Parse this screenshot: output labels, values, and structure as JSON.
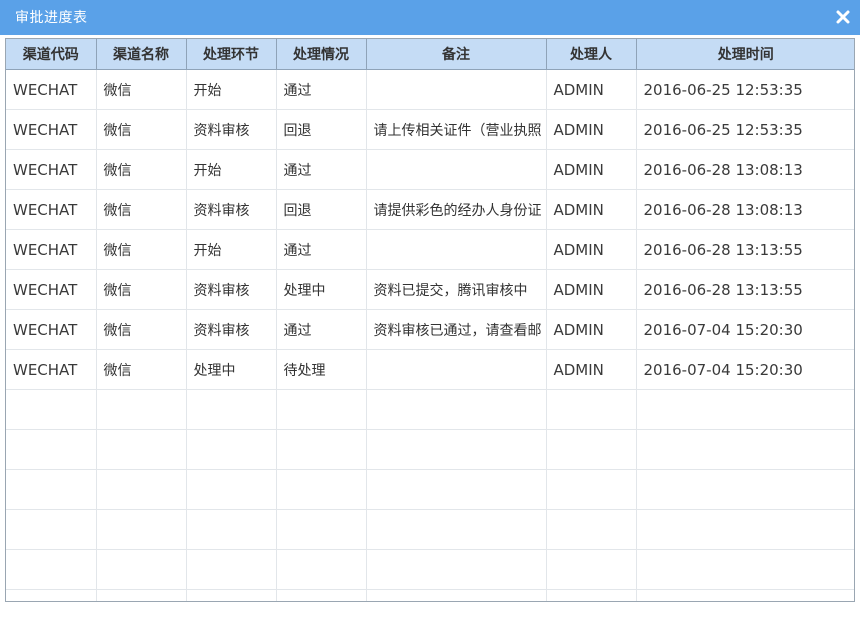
{
  "dialog": {
    "title": "审批进度表",
    "close_icon": "close-icon",
    "colors": {
      "titlebar": "#5aa1e8",
      "header_bg": "#c5dcf5"
    }
  },
  "table": {
    "columns": [
      "渠道代码",
      "渠道名称",
      "处理环节",
      "处理情况",
      "备注",
      "处理人",
      "处理时间"
    ],
    "rows": [
      [
        "WECHAT",
        "微信",
        "开始",
        "通过",
        "",
        "ADMIN",
        "2016-06-25 12:53:35"
      ],
      [
        "WECHAT",
        "微信",
        "资料审核",
        "回退",
        "请上传相关证件（营业执照",
        "ADMIN",
        "2016-06-25 12:53:35"
      ],
      [
        "WECHAT",
        "微信",
        "开始",
        "通过",
        "",
        "ADMIN",
        "2016-06-28 13:08:13"
      ],
      [
        "WECHAT",
        "微信",
        "资料审核",
        "回退",
        "请提供彩色的经办人身份证",
        "ADMIN",
        "2016-06-28 13:08:13"
      ],
      [
        "WECHAT",
        "微信",
        "开始",
        "通过",
        "",
        "ADMIN",
        "2016-06-28 13:13:55"
      ],
      [
        "WECHAT",
        "微信",
        "资料审核",
        "处理中",
        "资料已提交，腾讯审核中",
        "ADMIN",
        "2016-06-28 13:13:55"
      ],
      [
        "WECHAT",
        "微信",
        "资料审核",
        "通过",
        "资料审核已通过，请查看邮",
        "ADMIN",
        "2016-07-04 15:20:30"
      ],
      [
        "WECHAT",
        "微信",
        "处理中",
        "待处理",
        "",
        "ADMIN",
        "2016-07-04 15:20:30"
      ]
    ]
  }
}
